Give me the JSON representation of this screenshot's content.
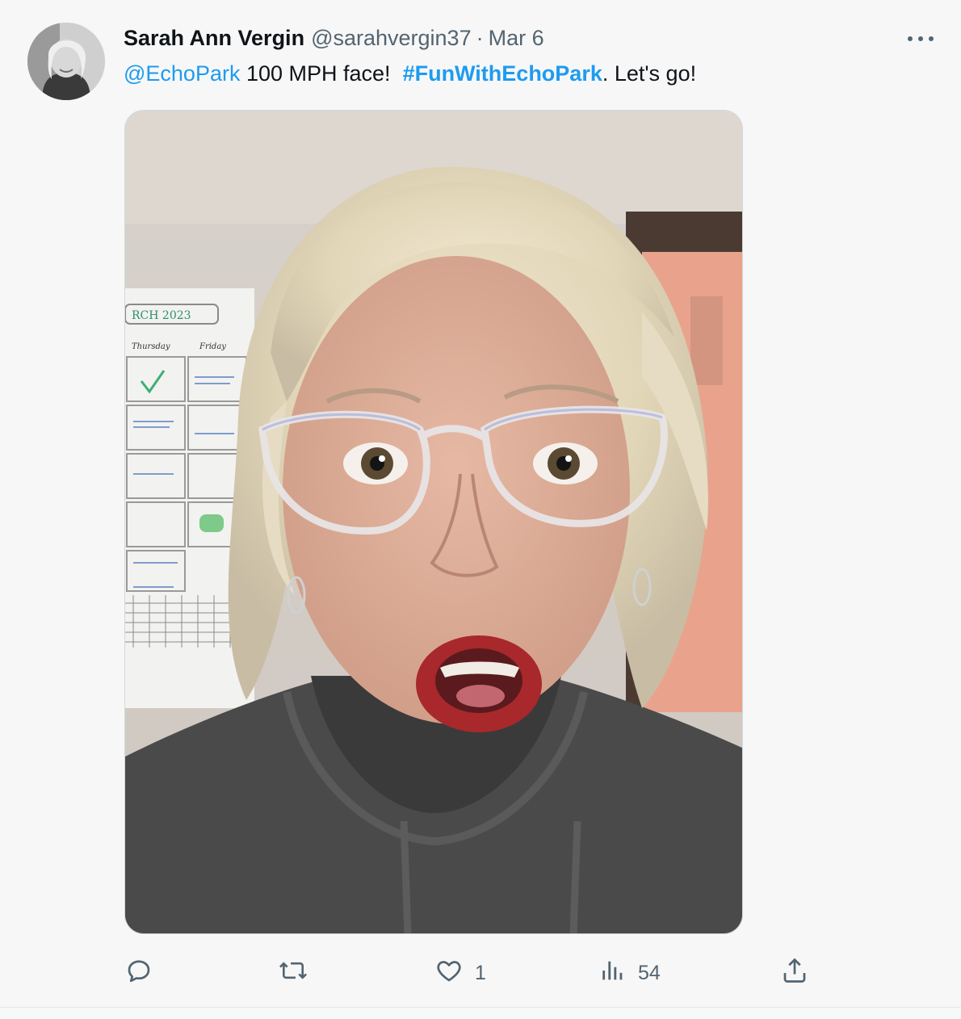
{
  "author": {
    "display_name": "Sarah Ann Vergin",
    "handle": "@sarahvergin37",
    "separator": "·",
    "date": "Mar 6",
    "avatar_icon": "profile-photo"
  },
  "tweet": {
    "mention": "@EchoPark",
    "text_part_1": " 100 MPH face!  ",
    "hashtag": "#FunWithEchoPark",
    "text_part_2": ". Let's go!"
  },
  "media": {
    "photo_lettering": {
      "calendar_header": "RCH 2023",
      "day_1": "Thursday",
      "day_2": "Friday"
    }
  },
  "actions": {
    "reply": {
      "icon": "reply-icon",
      "count": ""
    },
    "retweet": {
      "icon": "retweet-icon",
      "count": ""
    },
    "like": {
      "icon": "heart-icon",
      "count": "1"
    },
    "views": {
      "icon": "views-icon",
      "count": "54"
    },
    "share": {
      "icon": "share-icon",
      "count": ""
    }
  },
  "colors": {
    "link": "#1d9bf0",
    "text": "#0f1419",
    "muted": "#536471",
    "background": "#f7f7f7"
  }
}
